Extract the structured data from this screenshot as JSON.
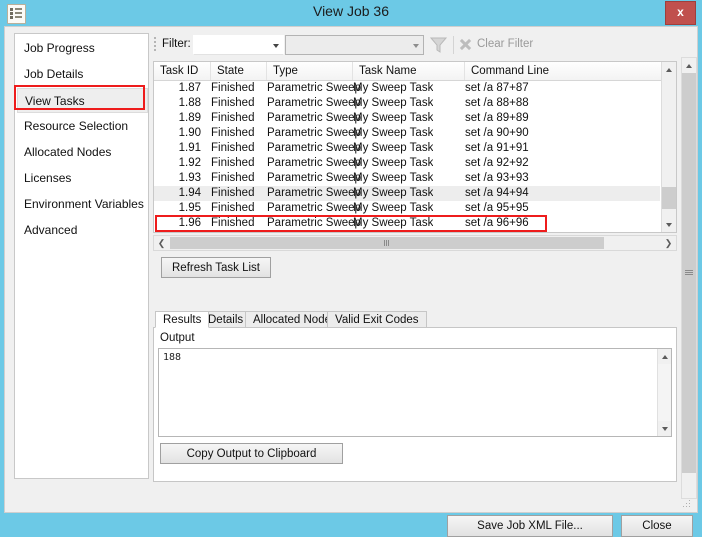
{
  "window": {
    "title": "View Job 36",
    "icon": "job-document-icon",
    "close_label": "x",
    "titlebar_color": "#6cc9e6",
    "accent_annotation_color": "#ee1c1c"
  },
  "sidebar": {
    "items": [
      {
        "label": "Job Progress",
        "selected": false
      },
      {
        "label": "Job Details",
        "selected": false
      },
      {
        "label": "View Tasks",
        "selected": true
      },
      {
        "label": "Resource Selection",
        "selected": false
      },
      {
        "label": "Allocated Nodes",
        "selected": false
      },
      {
        "label": "Licenses",
        "selected": false
      },
      {
        "label": "Environment Variables",
        "selected": false
      },
      {
        "label": "Advanced",
        "selected": false
      }
    ]
  },
  "filterbar": {
    "label": "Filter:",
    "field_combo_value": "",
    "field_combo_placeholder": "",
    "value_combo_value": "",
    "value_combo_placeholder": "",
    "funnel_icon": "funnel-icon",
    "clear_filter_label": "Clear Filter",
    "clear_filter_enabled": false
  },
  "grid": {
    "columns": [
      "Task ID",
      "State",
      "Type",
      "Task Name",
      "Command Line"
    ],
    "rows": [
      {
        "id": "1.87",
        "state": "Finished",
        "type": "Parametric Sweep",
        "name": "My Sweep Task",
        "cmd": "set /a 87+87",
        "selected": false
      },
      {
        "id": "1.88",
        "state": "Finished",
        "type": "Parametric Sweep",
        "name": "My Sweep Task",
        "cmd": "set /a 88+88",
        "selected": false
      },
      {
        "id": "1.89",
        "state": "Finished",
        "type": "Parametric Sweep",
        "name": "My Sweep Task",
        "cmd": "set /a 89+89",
        "selected": false
      },
      {
        "id": "1.90",
        "state": "Finished",
        "type": "Parametric Sweep",
        "name": "My Sweep Task",
        "cmd": "set /a 90+90",
        "selected": false
      },
      {
        "id": "1.91",
        "state": "Finished",
        "type": "Parametric Sweep",
        "name": "My Sweep Task",
        "cmd": "set /a 91+91",
        "selected": false
      },
      {
        "id": "1.92",
        "state": "Finished",
        "type": "Parametric Sweep",
        "name": "My Sweep Task",
        "cmd": "set /a 92+92",
        "selected": false
      },
      {
        "id": "1.93",
        "state": "Finished",
        "type": "Parametric Sweep",
        "name": "My Sweep Task",
        "cmd": "set /a 93+93",
        "selected": false
      },
      {
        "id": "1.94",
        "state": "Finished",
        "type": "Parametric Sweep",
        "name": "My Sweep Task",
        "cmd": "set /a 94+94",
        "selected": true
      },
      {
        "id": "1.95",
        "state": "Finished",
        "type": "Parametric Sweep",
        "name": "My Sweep Task",
        "cmd": "set /a 95+95",
        "selected": false
      },
      {
        "id": "1.96",
        "state": "Finished",
        "type": "Parametric Sweep",
        "name": "My Sweep Task",
        "cmd": "set /a 96+96",
        "selected": false
      }
    ]
  },
  "actions": {
    "refresh_task_list": "Refresh Task List",
    "copy_output": "Copy Output to Clipboard",
    "save_job_xml": "Save Job XML File...",
    "close": "Close"
  },
  "tabs": [
    {
      "label": "Results",
      "active": true
    },
    {
      "label": "Details",
      "active": false
    },
    {
      "label": "Allocated Nodes",
      "active": false
    },
    {
      "label": "Valid Exit Codes",
      "active": false
    }
  ],
  "results": {
    "output_label": "Output",
    "output_value": "188"
  }
}
